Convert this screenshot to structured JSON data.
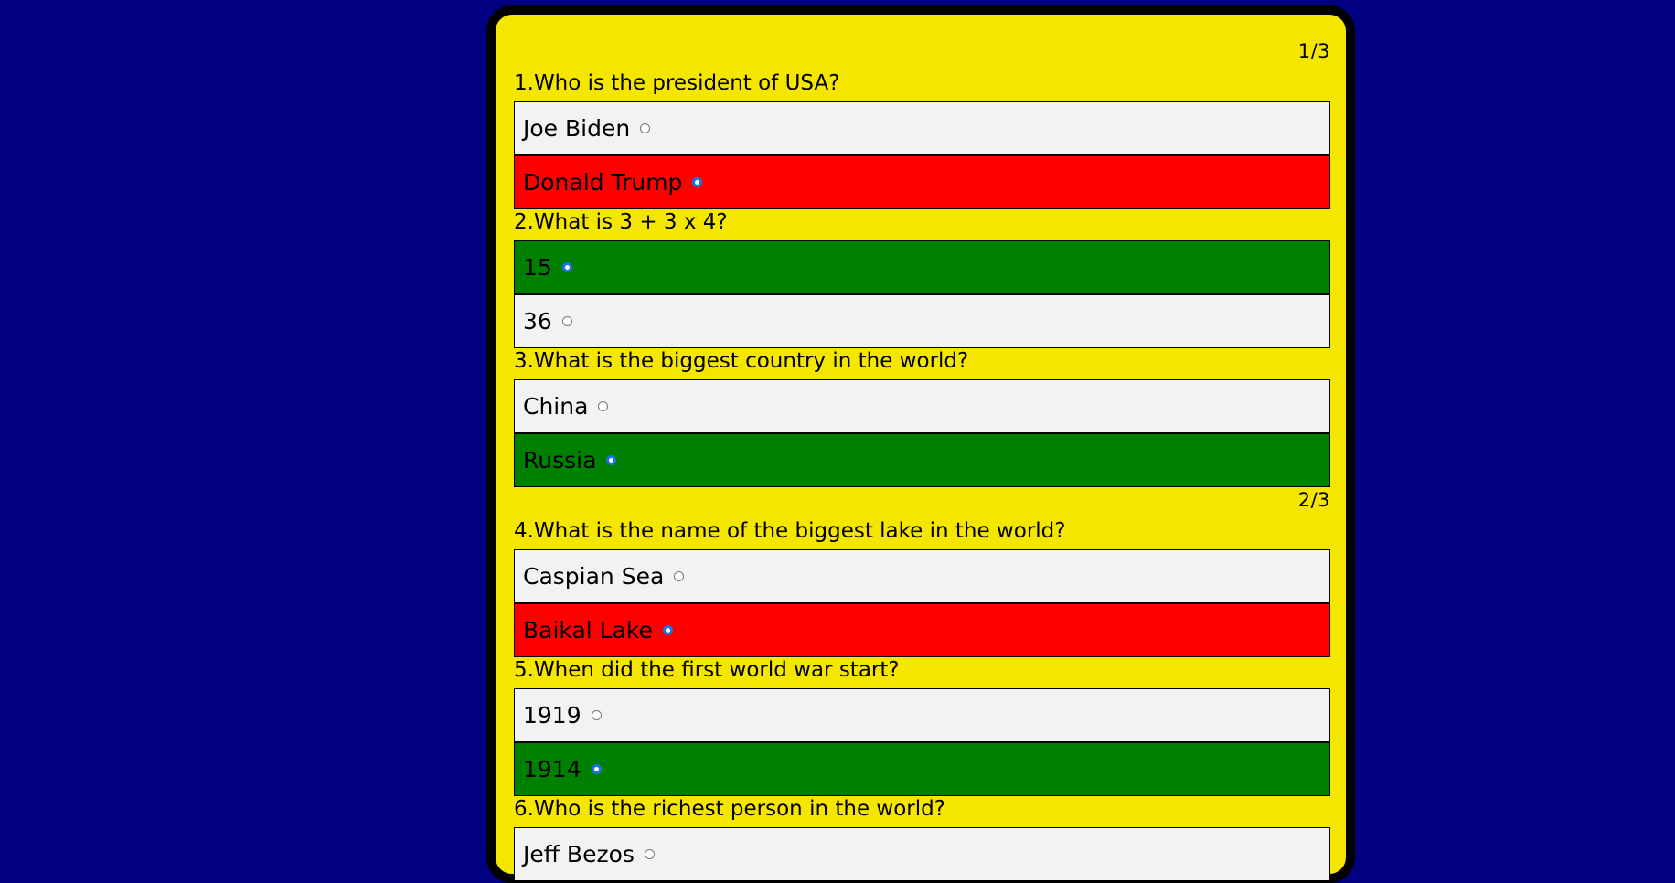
{
  "colors": {
    "page_background": "#000080",
    "card_background": "#f5e600",
    "neutral_option": "#f2f2f2",
    "wrong_option": "#ff0000",
    "correct_option": "#008000",
    "radio_selected": "#1a73e8"
  },
  "pages": [
    {
      "counter": "1/3"
    },
    {
      "counter": "2/3"
    }
  ],
  "questions": [
    {
      "text": "1.Who is the president of USA?",
      "options": [
        {
          "label": "Joe Biden",
          "selected": false,
          "state": "neutral"
        },
        {
          "label": "Donald Trump",
          "selected": true,
          "state": "wrong"
        }
      ]
    },
    {
      "text": "2.What is 3 + 3 x 4?",
      "options": [
        {
          "label": "15",
          "selected": true,
          "state": "correct"
        },
        {
          "label": "36",
          "selected": false,
          "state": "neutral"
        }
      ]
    },
    {
      "text": "3.What is the biggest country in the world?",
      "options": [
        {
          "label": "China",
          "selected": false,
          "state": "neutral"
        },
        {
          "label": "Russia",
          "selected": true,
          "state": "correct"
        }
      ]
    },
    {
      "text": "4.What is the name of the biggest lake in the world?",
      "options": [
        {
          "label": "Caspian Sea",
          "selected": false,
          "state": "neutral"
        },
        {
          "label": "Baikal Lake",
          "selected": true,
          "state": "wrong"
        }
      ]
    },
    {
      "text": "5.When did the first world war start?",
      "options": [
        {
          "label": "1919",
          "selected": false,
          "state": "neutral"
        },
        {
          "label": "1914",
          "selected": true,
          "state": "correct"
        }
      ]
    },
    {
      "text": "6.Who is the richest person in the world?",
      "options": [
        {
          "label": "Jeff Bezos",
          "selected": false,
          "state": "neutral"
        }
      ]
    }
  ]
}
